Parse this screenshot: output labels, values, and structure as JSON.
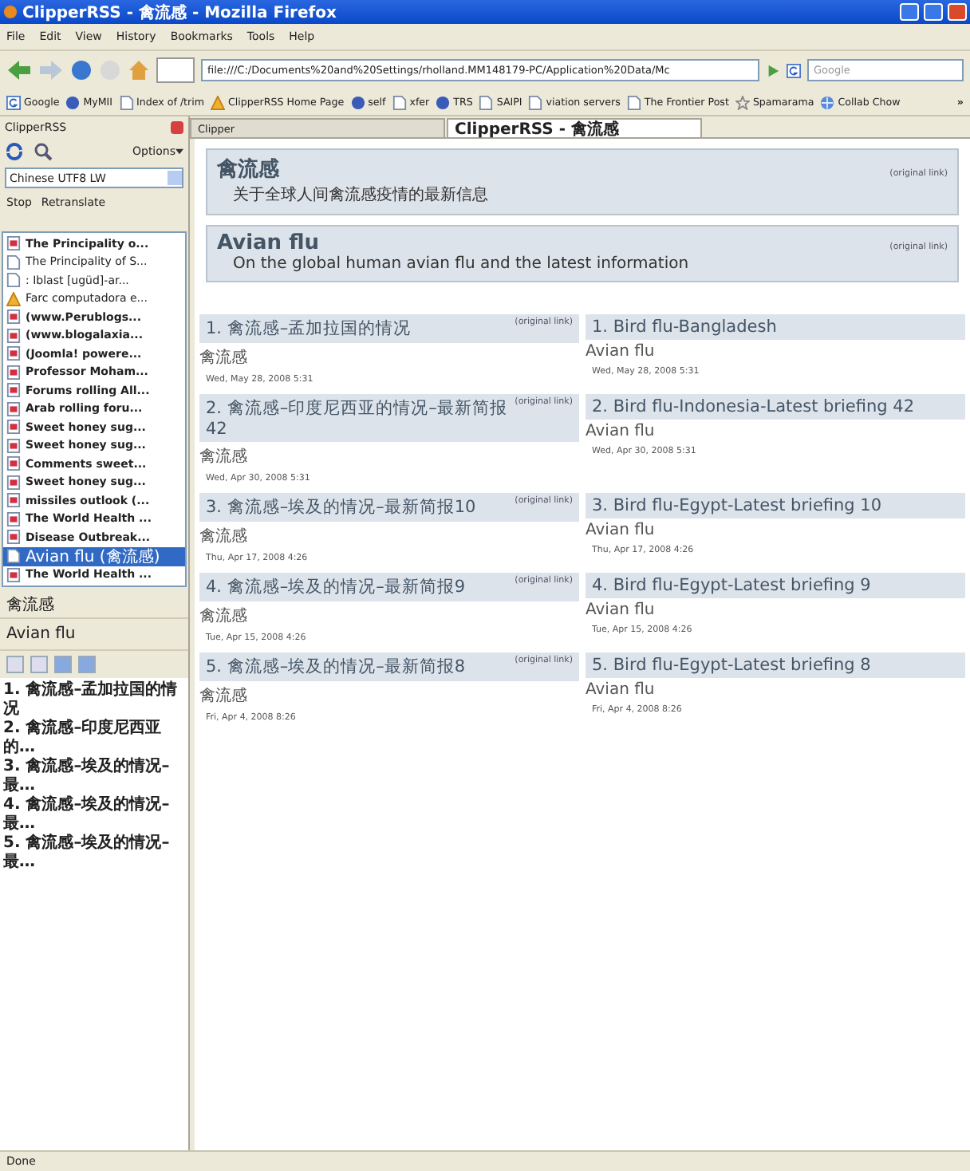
{
  "window": {
    "title": "ClipperRSS - 禽流感 - Mozilla Firefox"
  },
  "menu": [
    "File",
    "Edit",
    "View",
    "History",
    "Bookmarks",
    "Tools",
    "Help"
  ],
  "address": {
    "value": "file:///C:/Documents%20and%20Settings/rholland.MM148179-PC/Application%20Data/Mc"
  },
  "search": {
    "placeholder": "Google"
  },
  "bookmarks": [
    {
      "label": "Google",
      "kind": "google"
    },
    {
      "label": "MyMII",
      "kind": "m"
    },
    {
      "label": "Index of /trim",
      "kind": "page"
    },
    {
      "label": "ClipperRSS Home Page",
      "kind": "warn"
    },
    {
      "label": "self",
      "kind": "m"
    },
    {
      "label": "xfer",
      "kind": "page"
    },
    {
      "label": "TRS",
      "kind": "m"
    },
    {
      "label": "SAIPI",
      "kind": "page"
    },
    {
      "label": "viation servers",
      "kind": "page"
    },
    {
      "label": "The Frontier Post",
      "kind": "page"
    },
    {
      "label": "Spamarama",
      "kind": "star"
    },
    {
      "label": "Collab Chow",
      "kind": "globe"
    }
  ],
  "bookmarks_more": "»",
  "sidebar": {
    "title": "ClipperRSS",
    "options": "Options",
    "encoding": "Chinese UTF8 LW",
    "actions": [
      "Stop",
      "Retranslate"
    ],
    "feeds": [
      {
        "label": "The Principality o...",
        "kind": "feed",
        "unread": true,
        "selected": false
      },
      {
        "label": "The Principality of S...",
        "kind": "page",
        "unread": false,
        "selected": false
      },
      {
        "label": ": Iblast [ugüd]-ar...",
        "kind": "page",
        "unread": false,
        "selected": false
      },
      {
        "label": "Farc computadora e...",
        "kind": "warn",
        "unread": false,
        "selected": false
      },
      {
        "label": "(www.Perublogs...",
        "kind": "feed",
        "unread": true,
        "selected": false
      },
      {
        "label": "(www.blogalaxia...",
        "kind": "feed",
        "unread": true,
        "selected": false
      },
      {
        "label": "(Joomla! powere...",
        "kind": "feed",
        "unread": true,
        "selected": false
      },
      {
        "label": "Professor Moham...",
        "kind": "feed",
        "unread": true,
        "selected": false
      },
      {
        "label": "Forums rolling All...",
        "kind": "feed",
        "unread": true,
        "selected": false
      },
      {
        "label": "Arab rolling foru...",
        "kind": "feed",
        "unread": true,
        "selected": false
      },
      {
        "label": "Sweet honey sug...",
        "kind": "feed",
        "unread": true,
        "selected": false
      },
      {
        "label": "Sweet honey sug...",
        "kind": "feed",
        "unread": true,
        "selected": false
      },
      {
        "label": "Comments sweet...",
        "kind": "feed",
        "unread": true,
        "selected": false
      },
      {
        "label": "Sweet honey sug...",
        "kind": "feed",
        "unread": true,
        "selected": false
      },
      {
        "label": "missiles outlook (...",
        "kind": "feed",
        "unread": true,
        "selected": false
      },
      {
        "label": "The World Health ...",
        "kind": "feed",
        "unread": true,
        "selected": false
      },
      {
        "label": "Disease Outbreak...",
        "kind": "feed",
        "unread": true,
        "selected": false
      },
      {
        "label": "Avian flu (禽流感)",
        "kind": "page",
        "unread": false,
        "selected": true
      },
      {
        "label": "The World Health ...",
        "kind": "feed",
        "unread": true,
        "selected": false
      }
    ],
    "original_title": "禽流感",
    "translated_title": "Avian flu",
    "items": [
      "1. 禽流感–孟加拉国的情况",
      "2. 禽流感–印度尼西亚的…",
      "3. 禽流感–埃及的情况–最…",
      "4. 禽流感–埃及的情况–最…",
      "5. 禽流感–埃及的情况–最…"
    ]
  },
  "tabs": [
    {
      "label": "Clipper",
      "selected": false
    },
    {
      "label": "ClipperRSS - 禽流感",
      "selected": true
    }
  ],
  "feed_headers": [
    {
      "title": "禽流感",
      "description": "关于全球人间禽流感疫情的最新信息",
      "link": "(original link)"
    },
    {
      "title": "Avian flu",
      "description": "On the global human avian flu and the latest information",
      "link": "(original link)"
    }
  ],
  "articles": [
    {
      "original": {
        "title": "1. 禽流感–孟加拉国的情况",
        "link": "(original link)",
        "source": "禽流感",
        "date": "Wed, May 28, 2008 5:31"
      },
      "translated": {
        "title": "1. Bird flu-Bangladesh",
        "source": "Avian flu",
        "date": "Wed, May 28, 2008 5:31"
      }
    },
    {
      "original": {
        "title": "2. 禽流感–印度尼西亚的情况–最新简报 42",
        "link": "(original link)",
        "source": "禽流感",
        "date": "Wed, Apr 30, 2008 5:31"
      },
      "translated": {
        "title": "2. Bird flu-Indonesia-Latest briefing 42",
        "source": "Avian flu",
        "date": "Wed, Apr 30, 2008 5:31"
      }
    },
    {
      "original": {
        "title": "3. 禽流感–埃及的情况–最新简报10",
        "link": "(original link)",
        "source": "禽流感",
        "date": "Thu, Apr 17, 2008 4:26"
      },
      "translated": {
        "title": "3. Bird flu-Egypt-Latest briefing 10",
        "source": "Avian flu",
        "date": "Thu, Apr 17, 2008 4:26"
      }
    },
    {
      "original": {
        "title": "4. 禽流感–埃及的情况–最新简报9",
        "link": "(original link)",
        "source": "禽流感",
        "date": "Tue, Apr 15, 2008 4:26"
      },
      "translated": {
        "title": "4. Bird flu-Egypt-Latest briefing 9",
        "source": "Avian flu",
        "date": "Tue, Apr 15, 2008 4:26"
      }
    },
    {
      "original": {
        "title": "5. 禽流感–埃及的情况–最新简报8",
        "link": "(original link)",
        "source": "禽流感",
        "date": "Fri, Apr 4, 2008 8:26"
      },
      "translated": {
        "title": "5. Bird flu-Egypt-Latest briefing 8",
        "source": "Avian flu",
        "date": "Fri, Apr 4, 2008 8:26"
      }
    }
  ],
  "status_bar": {
    "text": "Done"
  }
}
